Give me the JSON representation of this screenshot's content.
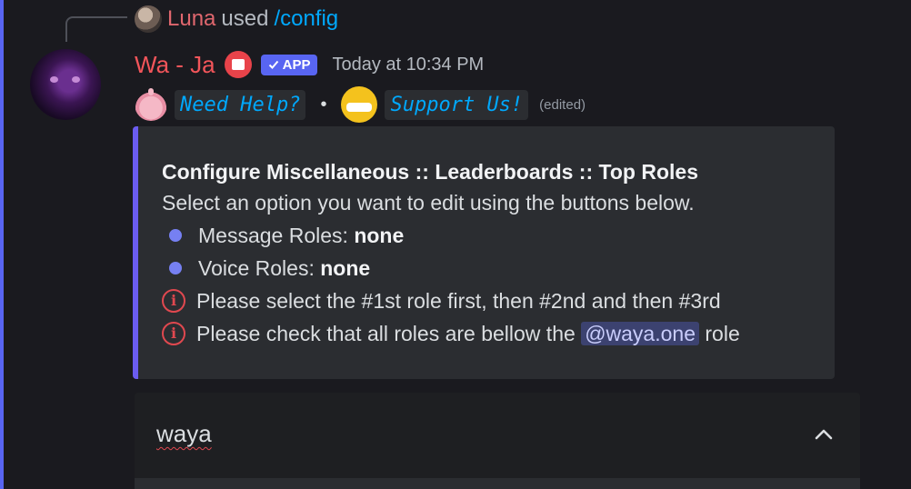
{
  "reply": {
    "username": "Luna",
    "used_text": "used",
    "command": "/config"
  },
  "message": {
    "author": "Wa - Ja",
    "app_tag": "APP",
    "timestamp": "Today at 10:34 PM",
    "links": [
      {
        "label": "Need Help?"
      },
      {
        "label": "Support Us!"
      }
    ],
    "separator": "•",
    "edited": "(edited)"
  },
  "embed": {
    "accent_color": "#6b5cf0",
    "title": "Configure Miscellaneous :: Leaderboards :: Top Roles",
    "description": "Select an option you want to edit using the buttons below.",
    "fields": [
      {
        "label": "Message Roles:",
        "value": "none"
      },
      {
        "label": "Voice Roles:",
        "value": "none"
      }
    ],
    "notes": [
      {
        "icon": "info-icon",
        "text": "Please select the #1st role first, then #2nd and then #3rd"
      },
      {
        "icon": "info-icon",
        "text_before": "Please check that all roles are bellow the",
        "mention": "@waya.one",
        "text_after": "role"
      }
    ]
  },
  "select_menu": {
    "value": "waya",
    "icon": "chevron-up-icon"
  }
}
